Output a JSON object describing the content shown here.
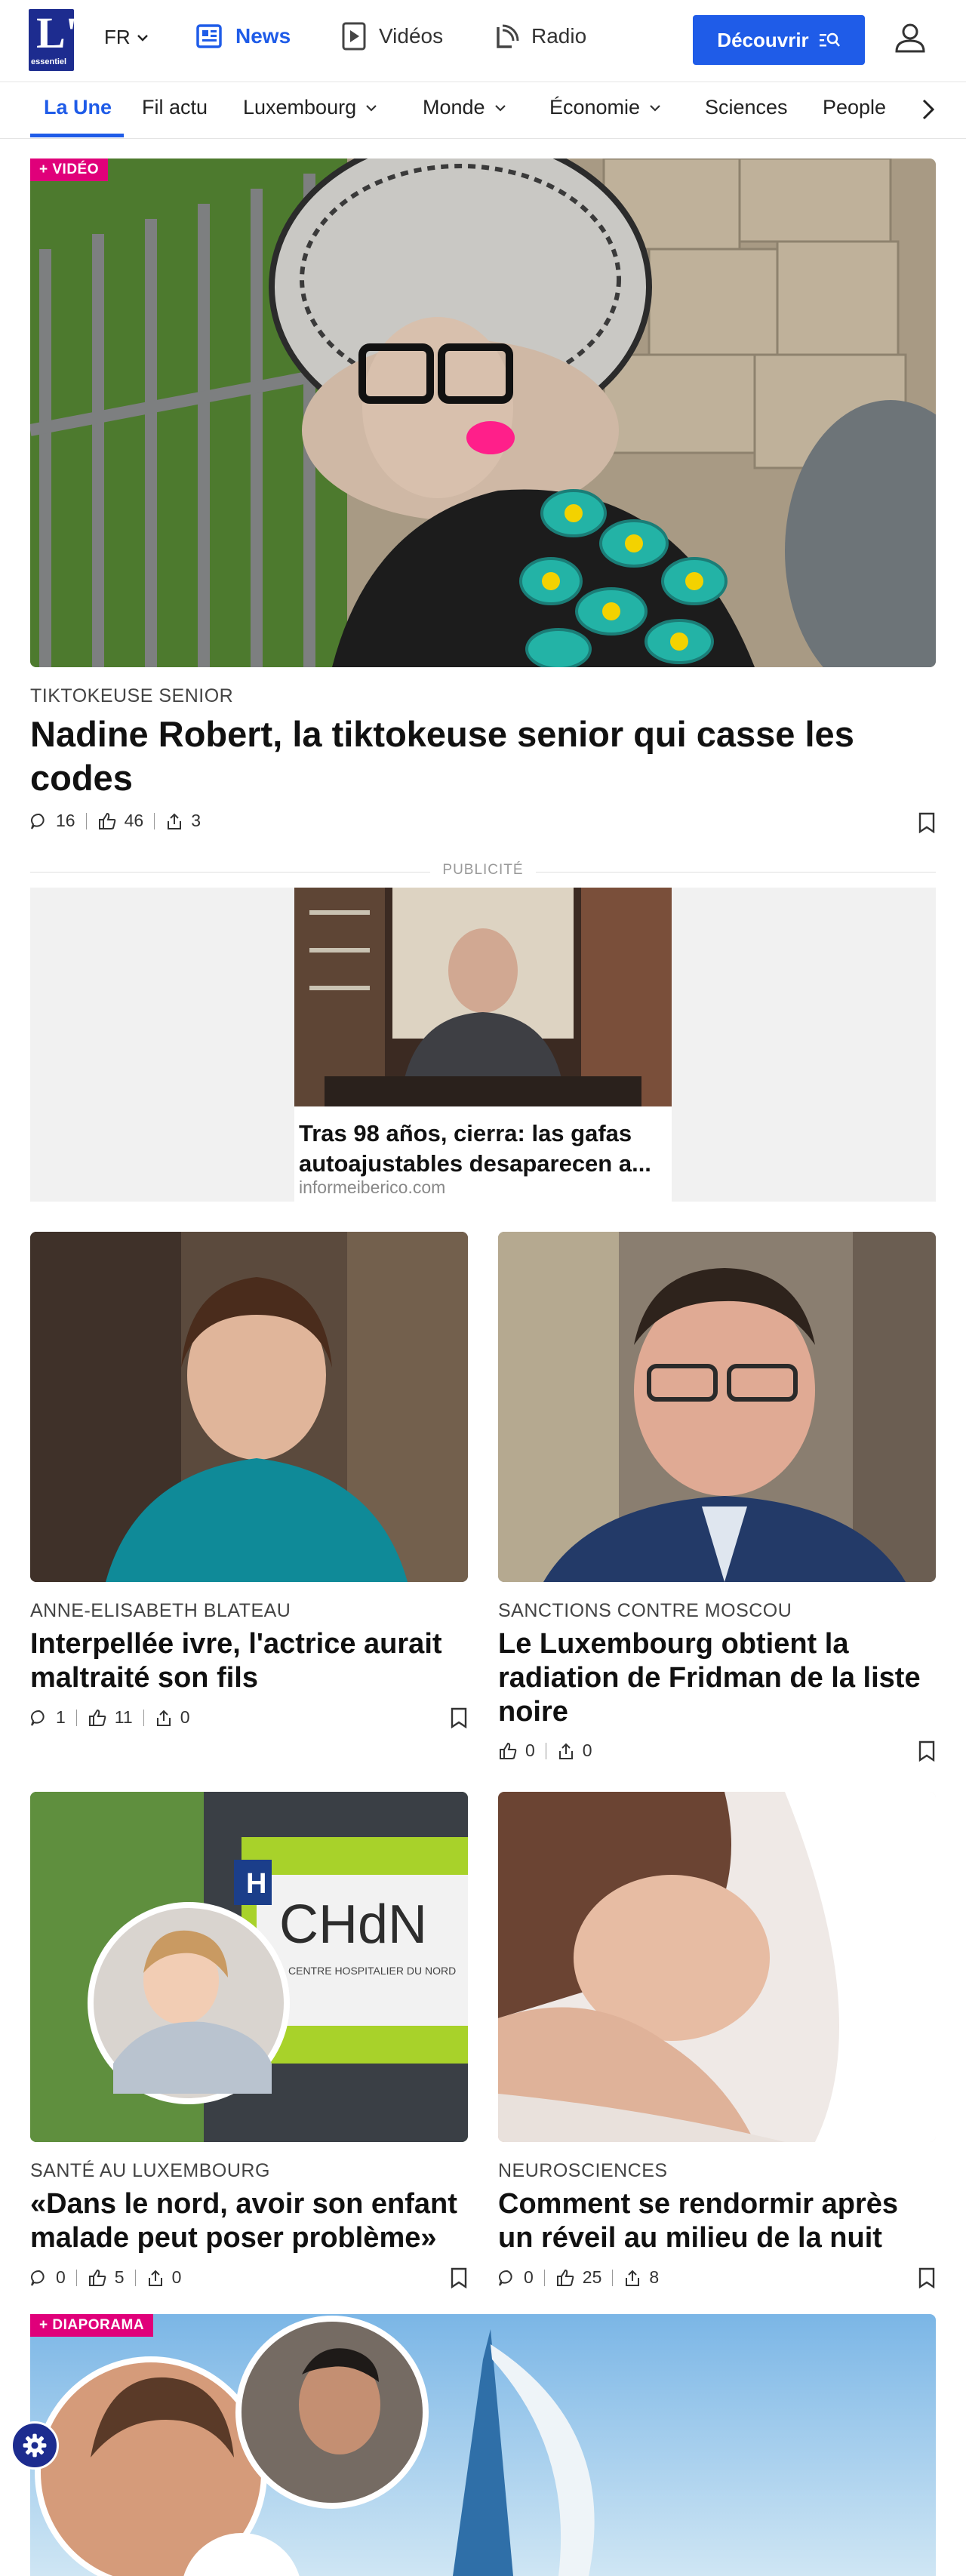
{
  "header": {
    "logo_text": "L'",
    "logo_sub": "essentiel",
    "lang": "FR",
    "nav": [
      {
        "label": "News",
        "icon": "news-icon"
      },
      {
        "label": "Vidéos",
        "icon": "play-icon"
      },
      {
        "label": "Radio",
        "icon": "radio-icon"
      }
    ],
    "cta_label": "Découvrir",
    "colors": {
      "accent": "#1f5ce8",
      "brand": "#1d2c8f",
      "tag": "#e0007a"
    }
  },
  "subnav": {
    "items": [
      "La Une",
      "Fil actu",
      "Luxembourg",
      "Monde",
      "Économie",
      "Sciences",
      "People"
    ]
  },
  "hero": {
    "tag": "+ VIDÉO",
    "kicker": "TIKTOKEUSE SENIOR",
    "title": "Nadine Robert, la tiktokeuse senior qui casse les codes",
    "comments": "16",
    "likes": "46",
    "shares": "3"
  },
  "ad": {
    "label": "PUBLICITÉ",
    "title": "Tras 98 años, cierra: las gafas autoajustables desaparecen a...",
    "source": "informeiberico.com"
  },
  "articles": [
    {
      "kicker": "ANNE-ELISABETH BLATEAU",
      "title": "Interpellée ivre, l'actrice aurait maltraité son fils",
      "comments": "1",
      "likes": "11",
      "shares": "0"
    },
    {
      "kicker": "SANCTIONS CONTRE MOSCOU",
      "title": "Le Luxembourg obtient la radiation de Fridman de la liste noire",
      "likes": "0",
      "shares": "0"
    },
    {
      "kicker": "SANTÉ AU LUXEMBOURG",
      "title": "«Dans le nord, avoir son enfant malade peut poser problème»",
      "comments": "0",
      "likes": "5",
      "shares": "0",
      "sign_text": "CHdN",
      "sign_sub": "CENTRE HOSPITALIER DU NORD"
    },
    {
      "kicker": "NEUROSCIENCES",
      "title": "Comment se rendormir après un réveil au milieu de la nuit",
      "comments": "0",
      "likes": "25",
      "shares": "8"
    }
  ],
  "diaporama": {
    "tag": "+ DIAPORAMA"
  }
}
